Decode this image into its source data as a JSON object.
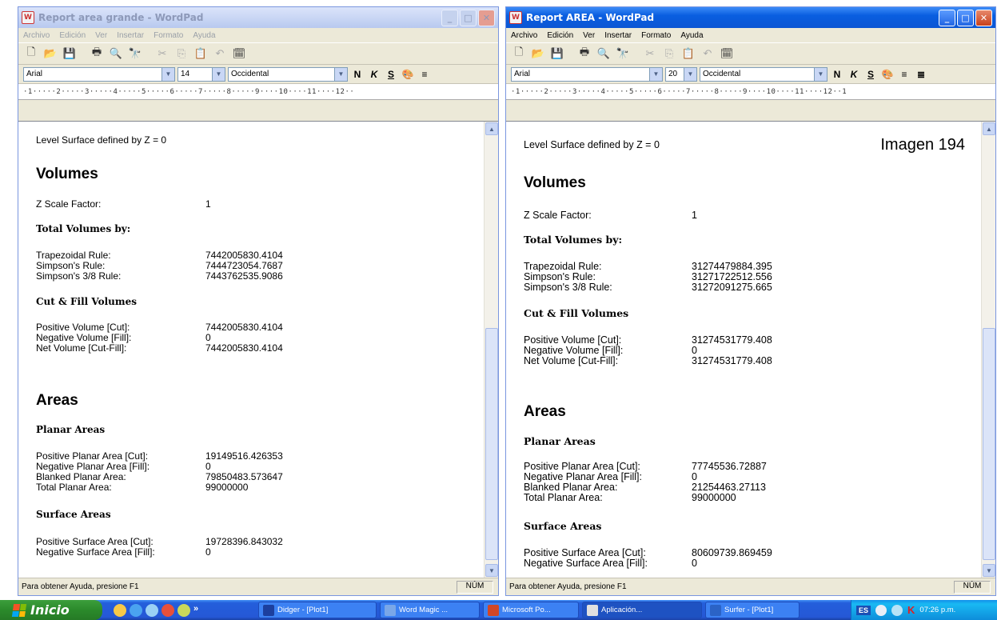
{
  "left_window": {
    "title": "Report area grande - WordPad",
    "menu": [
      "Archivo",
      "Edición",
      "Ver",
      "Insertar",
      "Formato",
      "Ayuda"
    ],
    "font": "Arial",
    "size": "14",
    "script": "Occidental",
    "ruler": "·1·····2·····3·····4·····5·····6·····7·····8·····9····10····11····12··",
    "status": "Para obtener Ayuda, presione F1",
    "status_num": "NÚM",
    "doc": {
      "level_surface": "Level Surface defined by Z = 0",
      "volumes_heading": "Volumes",
      "z_scale_label": "Z Scale Factor:",
      "z_scale_value": "1",
      "total_volumes_heading": "Total Volumes by:",
      "trapezoidal_label": "Trapezoidal Rule:",
      "trapezoidal_value": "7442005830.4104",
      "simpson_label": "Simpson's Rule:",
      "simpson_value": "7444723054.7687",
      "simpson38_label": "Simpson's 3/8 Rule:",
      "simpson38_value": "7443762535.9086",
      "cut_fill_heading": "Cut & Fill Volumes",
      "pos_vol_label": "Positive Volume [Cut]:",
      "pos_vol_value": "7442005830.4104",
      "neg_vol_label": "Negative Volume [Fill]:",
      "neg_vol_value": "0",
      "net_vol_label": "Net Volume [Cut-Fill]:",
      "net_vol_value": "7442005830.4104",
      "areas_heading": "Areas",
      "planar_heading": "Planar Areas",
      "pos_planar_label": "Positive Planar Area [Cut]:",
      "pos_planar_value": "19149516.426353",
      "neg_planar_label": "Negative Planar Area [Fill]:",
      "neg_planar_value": "0",
      "blanked_label": "Blanked Planar Area:",
      "blanked_value": "79850483.573647",
      "total_planar_label": "Total Planar Area:",
      "total_planar_value": "99000000",
      "surface_heading": "Surface Areas",
      "pos_surface_label": "Positive Surface Area [Cut]:",
      "pos_surface_value": "19728396.843032",
      "neg_surface_label": "Negative Surface Area [Fill]:",
      "neg_surface_value": "0"
    }
  },
  "right_window": {
    "title": "Report AREA - WordPad",
    "menu": [
      "Archivo",
      "Edición",
      "Ver",
      "Insertar",
      "Formato",
      "Ayuda"
    ],
    "font": "Arial",
    "size": "20",
    "script": "Occidental",
    "ruler": "·1·····2·····3·····4·····5·····6·····7·····8·····9····10····11····12··1",
    "status": "Para obtener Ayuda, presione F1",
    "status_num": "NÚM",
    "overlay_label": "Imagen 194",
    "doc": {
      "level_surface": "Level Surface defined by Z = 0",
      "volumes_heading": "Volumes",
      "z_scale_label": "Z Scale Factor:",
      "z_scale_value": "1",
      "total_volumes_heading": "Total Volumes by:",
      "trapezoidal_label": "Trapezoidal Rule:",
      "trapezoidal_value": "31274479884.395",
      "simpson_label": "Simpson's Rule:",
      "simpson_value": "31271722512.556",
      "simpson38_label": "Simpson's 3/8 Rule:",
      "simpson38_value": "31272091275.665",
      "cut_fill_heading": "Cut & Fill Volumes",
      "pos_vol_label": "Positive Volume [Cut]:",
      "pos_vol_value": "31274531779.408",
      "neg_vol_label": "Negative Volume [Fill]:",
      "neg_vol_value": "0",
      "net_vol_label": "Net Volume [Cut-Fill]:",
      "net_vol_value": "31274531779.408",
      "areas_heading": "Areas",
      "planar_heading": "Planar Areas",
      "pos_planar_label": "Positive Planar Area [Cut]:",
      "pos_planar_value": "77745536.72887",
      "neg_planar_label": "Negative Planar Area [Fill]:",
      "neg_planar_value": "0",
      "blanked_label": "Blanked Planar Area:",
      "blanked_value": "21254463.27113",
      "total_planar_label": "Total Planar Area:",
      "total_planar_value": "99000000",
      "surface_heading": "Surface Areas",
      "pos_surface_label": "Positive Surface Area [Cut]:",
      "pos_surface_value": "80609739.869459",
      "neg_surface_label": "Negative Surface Area [Fill]:",
      "neg_surface_value": "0"
    }
  },
  "taskbar": {
    "start_label": "Inicio",
    "tasks": [
      "Didger - [Plot1]",
      "Word Magic ...",
      "Microsoft Po...",
      "Aplicación...",
      "Surfer - [Plot1]"
    ],
    "language": "ES",
    "clock": "07:26 p.m."
  }
}
